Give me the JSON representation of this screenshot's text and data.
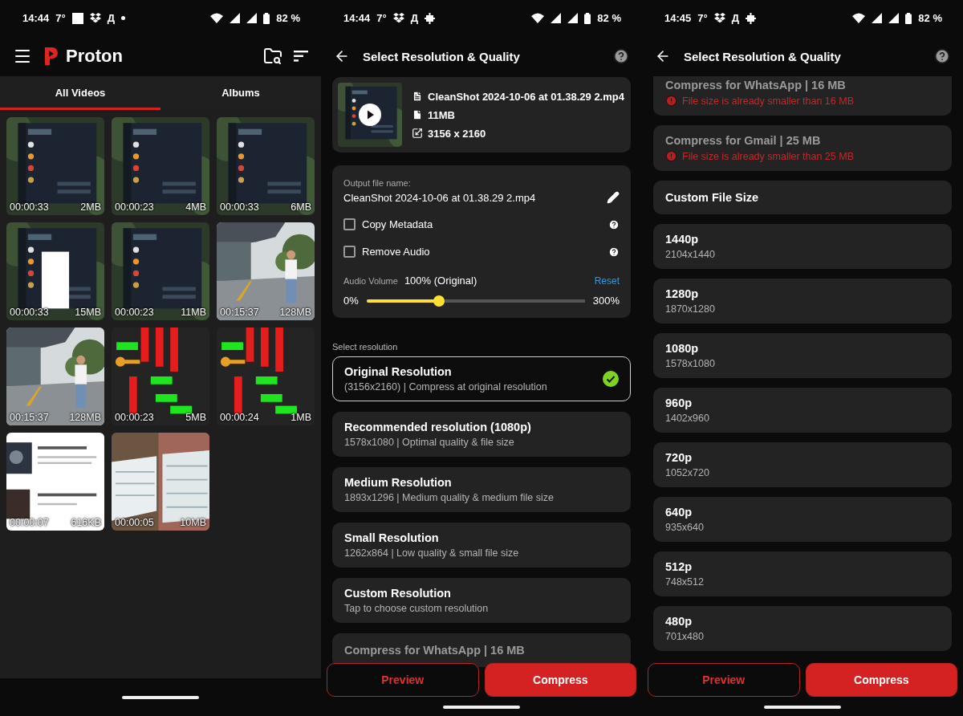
{
  "library_screen": {
    "status": {
      "time": "14:44",
      "temperature": "7°",
      "letter": "Д",
      "battery": "82 %"
    },
    "app_name": "Proton",
    "tabs": [
      {
        "label": "All Videos",
        "selected": true
      },
      {
        "label": "Albums",
        "selected": false
      }
    ],
    "videos": [
      {
        "duration": "00:00:33",
        "size": "2MB"
      },
      {
        "duration": "00:00:23",
        "size": "4MB"
      },
      {
        "duration": "00:00:33",
        "size": "6MB"
      },
      {
        "duration": "00:00:33",
        "size": "15MB"
      },
      {
        "duration": "00:00:23",
        "size": "11MB"
      },
      {
        "duration": "00:15:37",
        "size": "128MB"
      },
      {
        "duration": "00:15:37",
        "size": "128MB"
      },
      {
        "duration": "00:00:23",
        "size": "5MB"
      },
      {
        "duration": "00:00:24",
        "size": "1MB"
      },
      {
        "duration": "00:00:07",
        "size": "616KB"
      },
      {
        "duration": "00:00:05",
        "size": "10MB"
      }
    ]
  },
  "quality_screen": {
    "status": {
      "time": "14:44",
      "temperature": "7°",
      "letter": "Д",
      "battery": "82 %"
    },
    "title": "Select Resolution & Quality",
    "file": {
      "name": "CleanShot 2024-10-06 at 01.38.29 2.mp4",
      "size": "11MB",
      "dimensions": "3156 x 2160"
    },
    "output": {
      "label": "Output file name:",
      "file_name": "CleanShot 2024-10-06 at 01.38.29 2.mp4"
    },
    "options": [
      {
        "label": "Copy Metadata",
        "checked": false
      },
      {
        "label": "Remove Audio",
        "checked": false
      }
    ],
    "volume": {
      "label": "Audio Volume",
      "value": "100% (Original)",
      "reset": "Reset",
      "min": "0%",
      "max": "300%",
      "level": 0.333
    },
    "section_label": "Select resolution",
    "resolutions": [
      {
        "title": "Original Resolution",
        "subtitle": "(3156x2160) | Compress at original resolution",
        "selected": true,
        "disabled": false
      },
      {
        "title": "Recommended resolution (1080p)",
        "subtitle": "1578x1080 | Optimal quality & file size",
        "selected": false,
        "disabled": false
      },
      {
        "title": "Medium Resolution",
        "subtitle": "1893x1296 | Medium quality & medium file size",
        "selected": false,
        "disabled": false
      },
      {
        "title": "Small Resolution",
        "subtitle": "1262x864 | Low quality & small file size",
        "selected": false,
        "disabled": false
      },
      {
        "title": "Custom Resolution",
        "subtitle": "Tap to choose custom resolution",
        "selected": false,
        "disabled": false
      },
      {
        "title": "Compress for WhatsApp | 16 MB",
        "selected": false,
        "disabled": true
      }
    ],
    "buttons": {
      "preview": "Preview",
      "compress": "Compress"
    }
  },
  "quality_screen_scrolled": {
    "status": {
      "time": "14:45",
      "temperature": "7°",
      "letter": "Д",
      "battery": "82 %"
    },
    "title": "Select Resolution & Quality",
    "resolutions": [
      {
        "title": "Compress for WhatsApp | 16 MB",
        "warning": "File size is already smaller than 16 MB",
        "selected": false,
        "disabled": true
      },
      {
        "title": "Compress for Gmail | 25 MB",
        "warning": "File size is already smaller than 25 MB",
        "selected": false,
        "disabled": true
      },
      {
        "title": "Custom File Size",
        "selected": false,
        "disabled": false
      },
      {
        "title": "1440p",
        "subtitle": "2104x1440",
        "selected": false,
        "disabled": false
      },
      {
        "title": "1280p",
        "subtitle": "1870x1280",
        "selected": false,
        "disabled": false
      },
      {
        "title": "1080p",
        "subtitle": "1578x1080",
        "selected": false,
        "disabled": false
      },
      {
        "title": "960p",
        "subtitle": "1402x960",
        "selected": false,
        "disabled": false
      },
      {
        "title": "720p",
        "subtitle": "1052x720",
        "selected": false,
        "disabled": false
      },
      {
        "title": "640p",
        "subtitle": "935x640",
        "selected": false,
        "disabled": false
      },
      {
        "title": "512p",
        "subtitle": "748x512",
        "selected": false,
        "disabled": false
      },
      {
        "title": "480p",
        "subtitle": "701x480",
        "selected": false,
        "disabled": false
      }
    ],
    "buttons": {
      "preview": "Preview",
      "compress": "Compress"
    }
  }
}
